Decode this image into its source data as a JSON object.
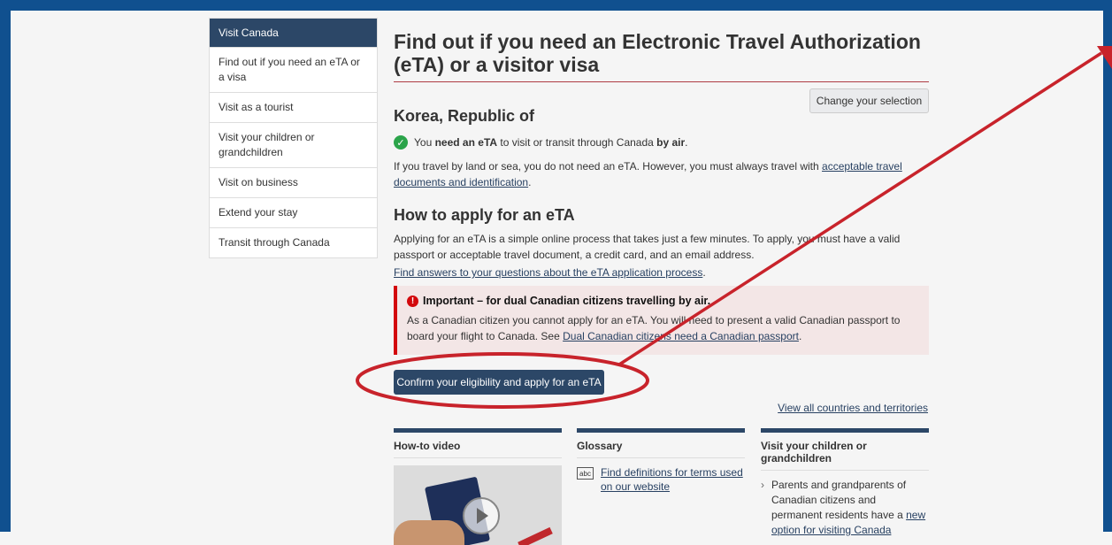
{
  "sidebar": {
    "header": "Visit Canada",
    "items": [
      {
        "label": "Find out if you need an eTA or a visa"
      },
      {
        "label": "Visit as a tourist"
      },
      {
        "label": "Visit your children or grandchildren"
      },
      {
        "label": "Visit on business"
      },
      {
        "label": "Extend your stay"
      },
      {
        "label": "Transit through Canada"
      }
    ]
  },
  "main": {
    "title": "Find out if you need an Electronic Travel Authorization (eTA) or a visitor visa",
    "change_button": "Change your selection",
    "country": "Korea, Republic of",
    "need": {
      "pre": "You ",
      "bold1": "need an eTA",
      "mid": " to visit or transit through Canada ",
      "bold2": "by air",
      "post": "."
    },
    "travel_text": "If you travel by land or sea, you do not need an eTA. However, you must always travel with ",
    "travel_link": "acceptable travel documents and identification",
    "travel_end": ".",
    "apply_heading": "How to apply for an eTA",
    "apply_text": "Applying for an eTA is a simple online process that takes just a few minutes. To apply, you must have a valid passport or acceptable travel document, a credit card, and an email address.",
    "faq_link": "Find answers to your questions about the eTA application process",
    "faq_end": ".",
    "alert": {
      "title": "Important – for dual Canadian citizens travelling by air.",
      "body": "As a Canadian citizen you cannot apply for an eTA. You will need to present a valid Canadian passport to board your flight to Canada. See ",
      "link": "Dual Canadian citizens need a Canadian passport",
      "end": "."
    },
    "confirm_button": "Confirm your eligibility and apply for an eTA",
    "view_all": "View all countries and territories"
  },
  "cards": {
    "video": {
      "title": "How-to video"
    },
    "glossary": {
      "title": "Glossary",
      "icon_text": "abc",
      "link": "Find definitions for terms used on our website"
    },
    "visit": {
      "title": "Visit your children or grandchildren",
      "text": "Parents and grandparents of Canadian citizens and permanent residents have a ",
      "link": "new option for visiting Canada"
    }
  },
  "colors": {
    "frame": "#10508f",
    "nav_dark": "#2c4767",
    "annotation": "#c8232b",
    "alert_red": "#d3080c"
  }
}
